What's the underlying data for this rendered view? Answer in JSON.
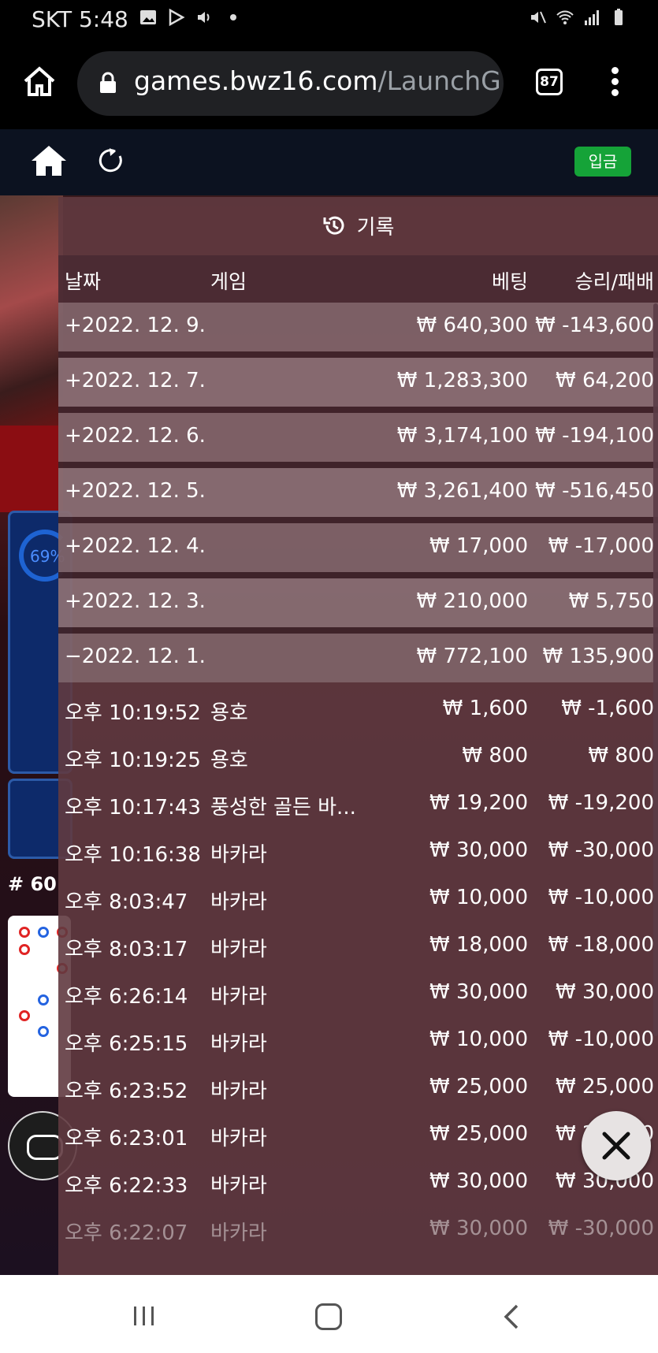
{
  "statusbar": {
    "carrier_time": "SKT 5:48"
  },
  "browser": {
    "url_host": "games.bwz16.com",
    "url_path": "/LaunchG",
    "tab_count": "87"
  },
  "gamebar": {
    "deposit_label": "입금"
  },
  "game": {
    "percent": "69%",
    "round": "# 60"
  },
  "history": {
    "title": "기록",
    "columns": {
      "date": "날짜",
      "game": "게임",
      "bet": "베팅",
      "result": "승리/패배"
    },
    "days": [
      {
        "date": "+2022. 12. 9.",
        "bet": "₩ 640,300",
        "result": "₩ -143,600"
      },
      {
        "date": "+2022. 12. 7.",
        "bet": "₩ 1,283,300",
        "result": "₩ 64,200"
      },
      {
        "date": "+2022. 12. 6.",
        "bet": "₩ 3,174,100",
        "result": "₩ -194,100"
      },
      {
        "date": "+2022. 12. 5.",
        "bet": "₩ 3,261,400",
        "result": "₩ -516,450"
      },
      {
        "date": "+2022. 12. 4.",
        "bet": "₩ 17,000",
        "result": "₩ -17,000"
      },
      {
        "date": "+2022. 12. 3.",
        "bet": "₩ 210,000",
        "result": "₩ 5,750"
      },
      {
        "date": "−2022. 12. 1.",
        "bet": "₩ 772,100",
        "result": "₩ 135,900"
      }
    ],
    "entries": [
      {
        "time": "오후 10:19:52",
        "game": "용호",
        "bet": "₩ 1,600",
        "result": "₩ -1,600"
      },
      {
        "time": "오후 10:19:25",
        "game": "용호",
        "bet": "₩ 800",
        "result": "₩ 800"
      },
      {
        "time": "오후 10:17:43",
        "game": "풍성한 골든 바...",
        "bet": "₩ 19,200",
        "result": "₩ -19,200"
      },
      {
        "time": "오후 10:16:38",
        "game": "바카라",
        "bet": "₩ 30,000",
        "result": "₩ -30,000"
      },
      {
        "time": "오후 8:03:47",
        "game": "바카라",
        "bet": "₩ 10,000",
        "result": "₩ -10,000"
      },
      {
        "time": "오후 8:03:17",
        "game": "바카라",
        "bet": "₩ 18,000",
        "result": "₩ -18,000"
      },
      {
        "time": "오후 6:26:14",
        "game": "바카라",
        "bet": "₩ 30,000",
        "result": "₩ 30,000"
      },
      {
        "time": "오후 6:25:15",
        "game": "바카라",
        "bet": "₩ 10,000",
        "result": "₩ -10,000"
      },
      {
        "time": "오후 6:23:52",
        "game": "바카라",
        "bet": "₩ 25,000",
        "result": "₩ 25,000"
      },
      {
        "time": "오후 6:23:01",
        "game": "바카라",
        "bet": "₩ 25,000",
        "result": "₩ 25,000"
      },
      {
        "time": "오후 6:22:33",
        "game": "바카라",
        "bet": "₩ 30,000",
        "result": "₩ 30,000"
      },
      {
        "time": "오후 6:22:07",
        "game": "바카라",
        "bet": "₩ 30,000",
        "result": "₩ -30,000"
      }
    ]
  },
  "colors": {
    "deposit_green": "#15a338",
    "panel": "#603a40",
    "accent_blue": "#1e63d2"
  }
}
